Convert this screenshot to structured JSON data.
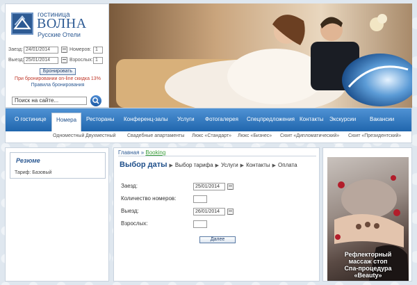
{
  "logo": {
    "small": "гостиница",
    "big": "ВОЛНА",
    "sub": "Русские Отели"
  },
  "booking": {
    "checkin_label": "Заезд:",
    "checkin_value": "24/01/2014",
    "rooms_label": "Номеров:",
    "rooms_value": "1",
    "checkout_label": "Выезд:",
    "checkout_value": "25/01/2014",
    "adults_label": "Взрослых:",
    "adults_value": "1",
    "book_button": "Бронировать",
    "discount_text": "При бронировании on-line скидка 13%",
    "rules_link": "Правила бронирования"
  },
  "search": {
    "value": "Поиск на сайте..."
  },
  "nav": {
    "items": [
      "О гостинице",
      "Номера",
      "Рестораны",
      "Конференц-залы",
      "Услуги",
      "Фотогалерея",
      "Спецпредложения",
      "Контакты",
      "Экскурсии",
      "Вакансии"
    ],
    "sub_items": [
      "Одноместный",
      "Двухместный",
      "Свадебные апартаменты",
      "Люкс «Стандарт»",
      "Люкс «Бизнес»",
      "Сюит «Дипломатический»",
      "Сюит «Президентский»"
    ]
  },
  "resume": {
    "title": "Резюме",
    "tariff": "Тариф: Базовый"
  },
  "breadcrumb": {
    "home": "Главная",
    "sep": "»",
    "current": "Booking"
  },
  "steps": [
    "Выбор даты",
    "Выбор тарифа",
    "Услуги",
    "Контакты",
    "Оплата"
  ],
  "form": {
    "checkin_label": "Заезд:",
    "checkin_value": "25/01/2014",
    "rooms_label": "Количество номеров:",
    "rooms_value": "",
    "checkout_label": "Выезд:",
    "checkout_value": "26/01/2014",
    "adults_label": "Взрослых:",
    "adults_value": "",
    "next_button": "Далее"
  },
  "ad": {
    "line1": "Рефлекторный",
    "line2": "массаж стоп",
    "line3": "Спа-процедура",
    "line4": "«Beauty»"
  },
  "colors": {
    "nav_top": "#4f92d4",
    "nav_bottom": "#2066ad",
    "brand": "#2d5a93",
    "discount": "#c0392b",
    "crumb_current": "#3a9d3a"
  }
}
